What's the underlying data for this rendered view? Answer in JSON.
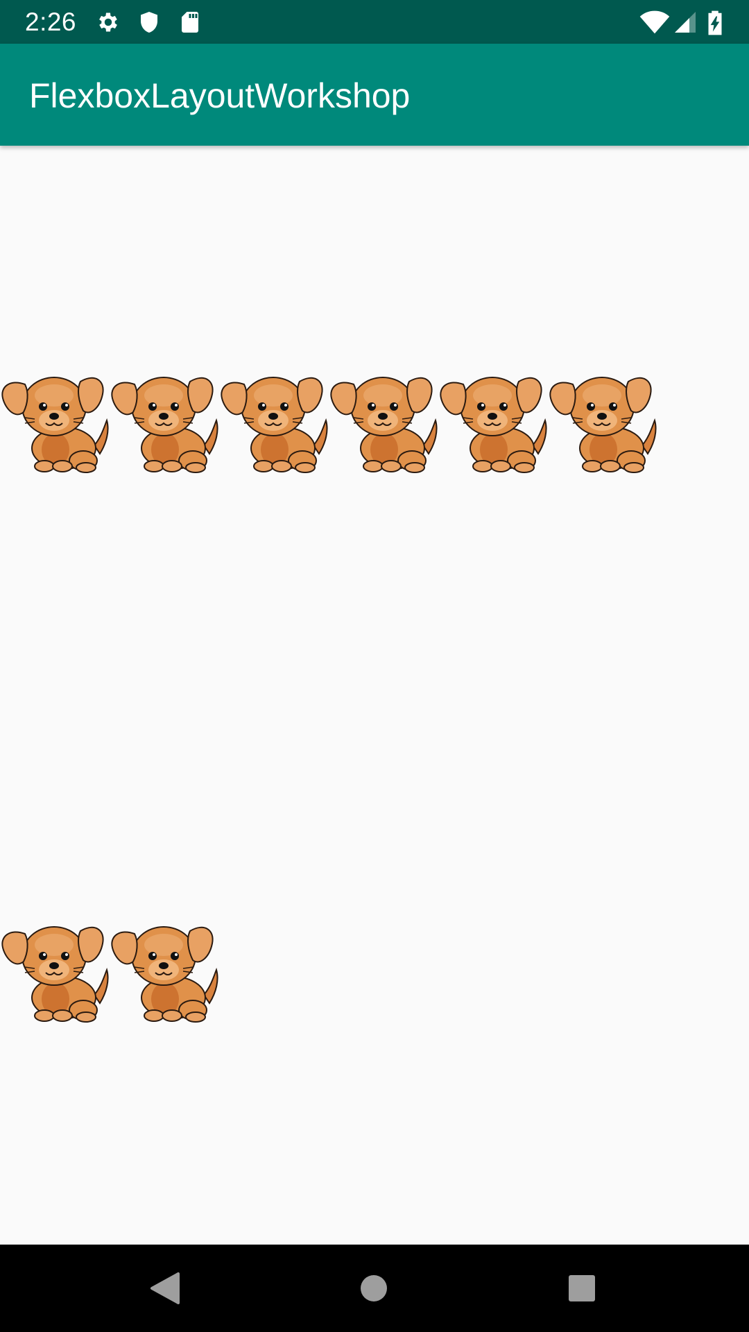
{
  "status_bar": {
    "time": "2:26",
    "icons_left": [
      "gear-icon",
      "shield-icon",
      "sd-card-icon"
    ],
    "icons_right": [
      "wifi-icon",
      "cell-signal-icon",
      "battery-charging-icon"
    ]
  },
  "app_bar": {
    "title": "FlexboxLayoutWorkshop"
  },
  "content": {
    "rows": [
      {
        "items": [
          "puppy-image",
          "puppy-image",
          "puppy-image",
          "puppy-image",
          "puppy-image",
          "puppy-image"
        ]
      },
      {
        "items": [
          "puppy-image",
          "puppy-image"
        ]
      }
    ]
  },
  "nav_bar": {
    "buttons": [
      "back-icon",
      "home-icon",
      "recents-icon"
    ]
  },
  "colors": {
    "status_bar": "#00594f",
    "app_bar": "#00897b",
    "background": "#fafafa",
    "nav_bar": "#000000",
    "puppy_fur": "#e0914a"
  }
}
